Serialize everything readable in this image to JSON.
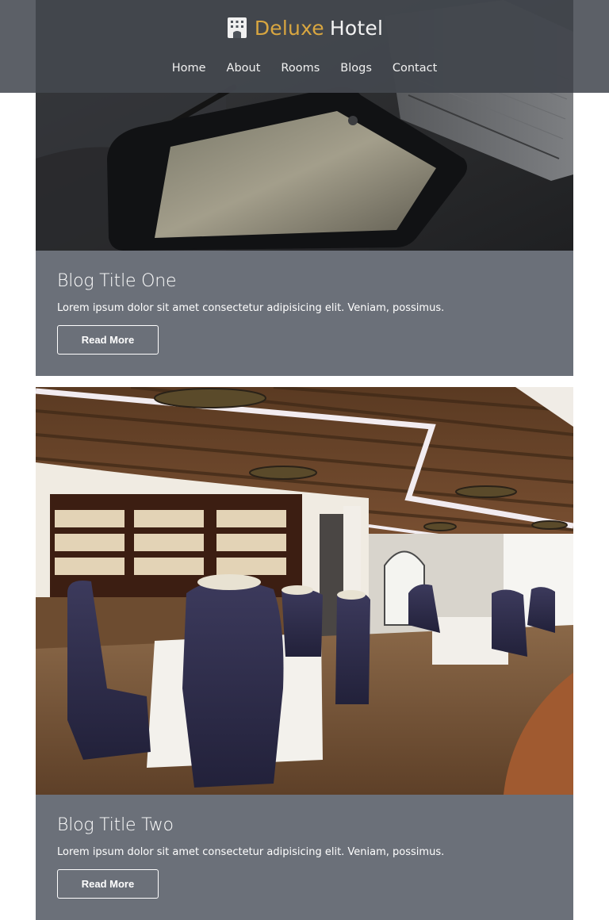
{
  "header": {
    "brand": {
      "icon": "hotel-building-icon",
      "accent_text": "Deluxe",
      "text": "Hotel",
      "accent_color": "#d8a640"
    },
    "nav": [
      {
        "label": "Home"
      },
      {
        "label": "About"
      },
      {
        "label": "Rooms"
      },
      {
        "label": "Blogs"
      },
      {
        "label": "Contact"
      }
    ]
  },
  "posts": [
    {
      "image": "tablet-and-notebook-photo",
      "title": "Blog Title One",
      "excerpt": "Lorem ipsum dolor sit amet consectetur adipisicing elit. Veniam, possimus.",
      "button_label": "Read More"
    },
    {
      "image": "restaurant-dining-room-photo",
      "title": "Blog Title Two",
      "excerpt": "Lorem ipsum dolor sit amet consectetur adipisicing elit. Veniam, possimus.",
      "button_label": "Read More"
    }
  ],
  "colors": {
    "panel": "#6b7079",
    "header_overlay": "#4e535a"
  }
}
